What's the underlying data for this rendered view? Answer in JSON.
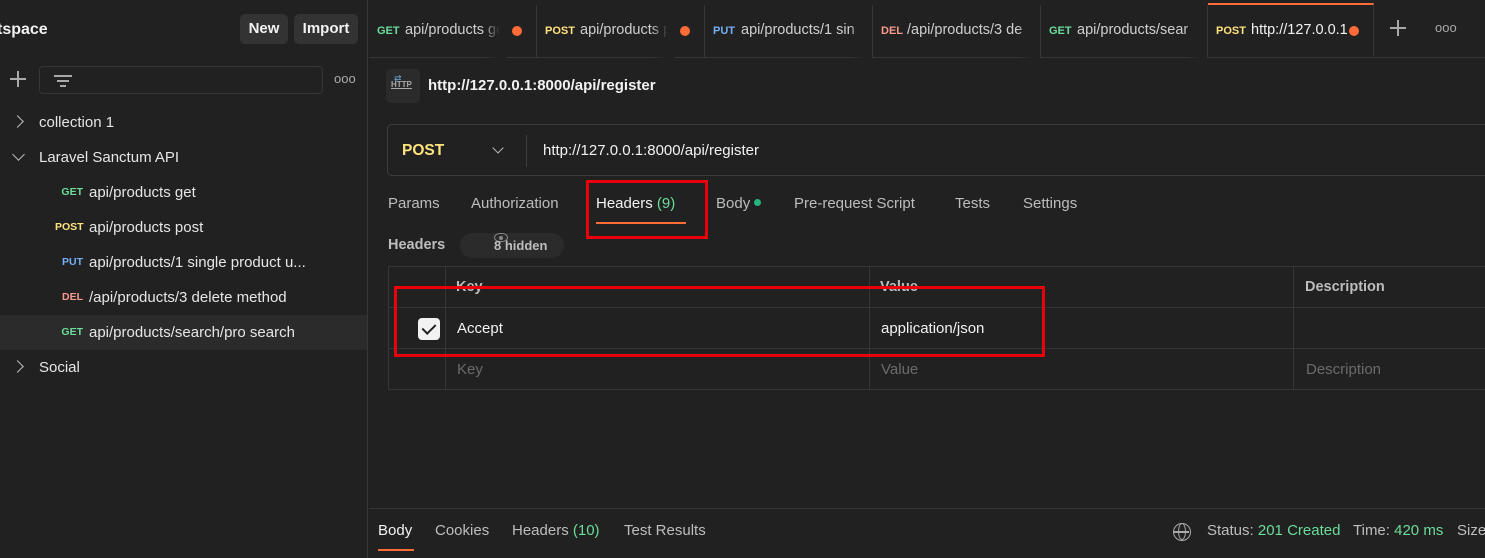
{
  "sidebar": {
    "workspace_title": "tspace",
    "new_label": "New",
    "import_label": "Import",
    "more_glyph": "ooo",
    "tree": {
      "collection1": "collection 1",
      "laravel": "Laravel Sanctum API",
      "social": "Social",
      "requests": [
        {
          "method": "GET",
          "name": "api/products get"
        },
        {
          "method": "POST",
          "name": "api/products post"
        },
        {
          "method": "PUT",
          "name": "api/products/1 single product u..."
        },
        {
          "method": "DEL",
          "name": "/api/products/3 delete method"
        },
        {
          "method": "GET",
          "name": "api/products/search/pro search"
        }
      ]
    }
  },
  "tabs": [
    {
      "method": "GET",
      "name": "api/products ge"
    },
    {
      "method": "POST",
      "name": "api/products p"
    },
    {
      "method": "PUT",
      "name": "api/products/1 sin"
    },
    {
      "method": "DEL",
      "name": "/api/products/3 de"
    },
    {
      "method": "GET",
      "name": "api/products/sear"
    },
    {
      "method": "POST",
      "name": "http://127.0.0.1"
    }
  ],
  "tabs_more_glyph": "ooo",
  "request": {
    "icon_text": "HTTP",
    "title": "http://127.0.0.1:8000/api/register",
    "method": "POST",
    "url": "http://127.0.0.1:8000/api/register",
    "tabs": {
      "params": "Params",
      "authorization": "Authorization",
      "headers": "Headers",
      "headers_count": "(9)",
      "body": "Body",
      "prerequest": "Pre-request Script",
      "tests": "Tests",
      "settings": "Settings"
    },
    "headers_label": "Headers",
    "hidden_label": "8 hidden",
    "table": {
      "col_key": "Key",
      "col_value": "Value",
      "col_description": "Description",
      "rows": [
        {
          "key": "Accept",
          "value": "application/json",
          "description": "",
          "checked": true
        }
      ],
      "placeholder": {
        "key": "Key",
        "value": "Value",
        "description": "Description"
      }
    }
  },
  "response": {
    "tabs": {
      "body": "Body",
      "cookies": "Cookies",
      "headers": "Headers",
      "headers_count": "(10)",
      "test_results": "Test Results"
    },
    "status_label": "Status:",
    "status_value": "201 Created",
    "time_label": "Time:",
    "time_value": "420 ms",
    "size_label": "Size"
  },
  "colors": {
    "accent": "#ff6c37",
    "get": "#6bdd9a",
    "post": "#ffe47e",
    "put": "#74aef6",
    "del": "#f79a8e",
    "highlight": "#e8000b"
  }
}
